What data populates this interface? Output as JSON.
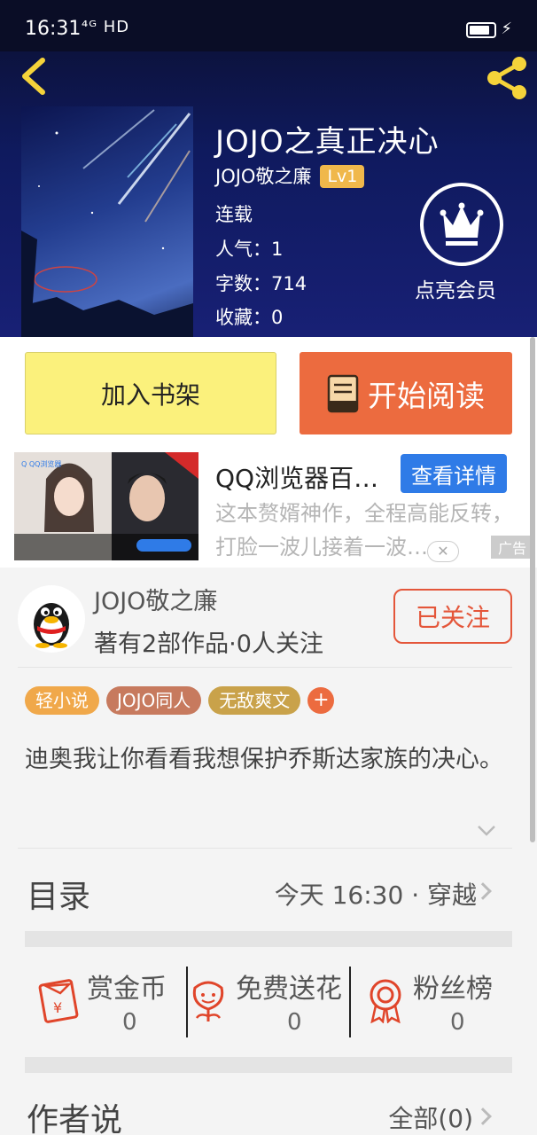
{
  "status_bar": {
    "time": "16:31",
    "network": "⁴ᴳ HD"
  },
  "book": {
    "title": "JOJO之真正决心",
    "author": "JOJO敬之廉",
    "level": "Lv1",
    "status": "连载",
    "popularity": "人气：1",
    "word_count": "字数：714",
    "favorites": "收藏：0"
  },
  "vip": {
    "label": "点亮会员"
  },
  "actions": {
    "add_shelf": "加入书架",
    "start_read": "开始阅读"
  },
  "ad": {
    "title": "QQ浏览器百…",
    "detail_button": "查看详情",
    "description": "这本赘婿神作，全程高能反转，打脸一波儿接着一波…",
    "tag": "广告"
  },
  "author_card": {
    "name": "JOJO敬之廉",
    "stats": "著有2部作品·0人关注",
    "follow_button": "已关注"
  },
  "tags": [
    {
      "label": "轻小说",
      "color": "#f0a84a"
    },
    {
      "label": "JOJO同人",
      "color": "#c77a5e"
    },
    {
      "label": "无敌爽文",
      "color": "#c9a24a"
    }
  ],
  "description": "迪奥我让你看看我想保护乔斯达家族的决心。",
  "catalog": {
    "title": "目录",
    "latest": "今天 16:30 · 穿越"
  },
  "rewards": [
    {
      "label": "赏金币",
      "count": "0"
    },
    {
      "label": "免费送花",
      "count": "0"
    },
    {
      "label": "粉丝榜",
      "count": "0"
    }
  ],
  "author_says": {
    "title": "作者说",
    "all": "全部(0)"
  },
  "colors": {
    "accent_orange": "#ec6b3f",
    "yellow_button": "#fbf17c",
    "follow_red": "#e4563a",
    "ad_blue": "#2f7be7"
  }
}
